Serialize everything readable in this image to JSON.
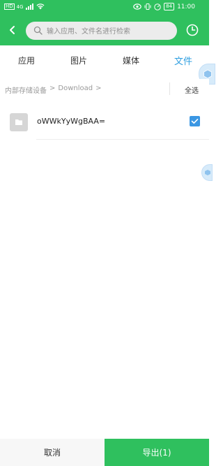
{
  "status_bar": {
    "time": "11:00",
    "battery": "84",
    "network": "4G",
    "hd": "HD"
  },
  "header": {
    "search_placeholder": "输入应用、文件名进行检索"
  },
  "tabs": [
    {
      "label": "应用"
    },
    {
      "label": "图片"
    },
    {
      "label": "媒体"
    },
    {
      "label": "文件"
    }
  ],
  "active_tab": "文件",
  "path": {
    "root": "内部存储设备",
    "sep1": ">",
    "folder": "Download",
    "sep2": ">",
    "select_all_label": "全选"
  },
  "files": [
    {
      "name": "oWWkYyWgBAA=",
      "checked": true
    }
  ],
  "bottom": {
    "cancel_label": "取消",
    "export_label": "导出(1)"
  },
  "colors": {
    "brand_green": "#2fc05e",
    "active_blue": "#2f9fe0",
    "checkbox_blue": "#3b97e3"
  }
}
